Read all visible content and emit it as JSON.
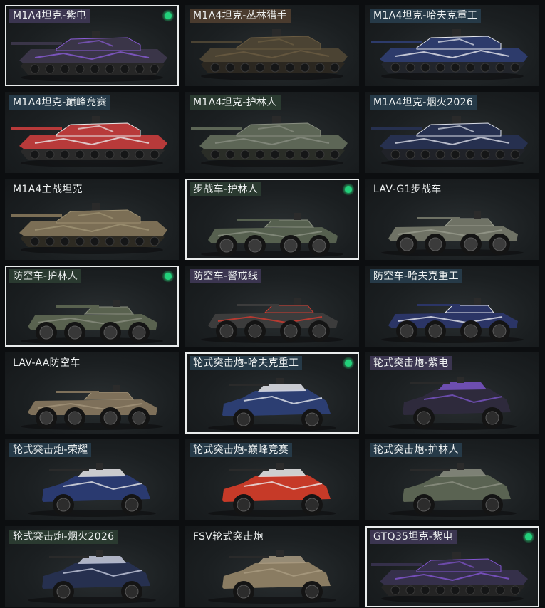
{
  "vehicles": [
    {
      "label": "M1A4坦克-紫电",
      "type": "tank",
      "selected": true,
      "label_bg": "#3b3550",
      "body": "#3a3548",
      "accent": "#8a5cd6",
      "wheel": "#262626"
    },
    {
      "label": "M1A4坦克-丛林猎手",
      "type": "tank",
      "selected": false,
      "label_bg": "#4a3b2e",
      "body": "#4b4333",
      "accent": "#6b5c42",
      "wheel": "#2b2720"
    },
    {
      "label": "M1A4坦克-哈夫克重工",
      "type": "tank",
      "selected": false,
      "label_bg": "#263a48",
      "body": "#2d3b6b",
      "accent": "#e7e9ef",
      "wheel": "#22252b"
    },
    {
      "label": "M1A4坦克-巅峰竞赛",
      "type": "tank",
      "selected": false,
      "label_bg": "#263a48",
      "body": "#b83a3a",
      "accent": "#e9e9ea",
      "wheel": "#2a2a2a"
    },
    {
      "label": "M1A4坦克-护林人",
      "type": "tank",
      "selected": false,
      "label_bg": "#2a3a30",
      "body": "#5d6656",
      "accent": "#8a8f82",
      "wheel": "#2a2d27"
    },
    {
      "label": "M1A4坦克-烟火2026",
      "type": "tank",
      "selected": false,
      "label_bg": "#263a48",
      "body": "#26304f",
      "accent": "#dcdfe8",
      "wheel": "#202228"
    },
    {
      "label": "M1A4主战坦克",
      "type": "tank",
      "selected": false,
      "label_bg": "transparent",
      "body": "#7b6e55",
      "accent": "#a09374",
      "wheel": "#2d2a22"
    },
    {
      "label": "步战车-护林人",
      "type": "ifv",
      "selected": true,
      "label_bg": "#2a3a30",
      "body": "#56604f",
      "accent": "#8b9182",
      "wheel": "#3a3a3a"
    },
    {
      "label": "LAV-G1步战车",
      "type": "ifv",
      "selected": false,
      "label_bg": "transparent",
      "body": "#6f7265",
      "accent": "#989b8d",
      "wheel": "#3b3b3b"
    },
    {
      "label": "防空车-护林人",
      "type": "ifv",
      "selected": true,
      "label_bg": "#2a3a30",
      "body": "#59624f",
      "accent": "#8a8f80",
      "wheel": "#383838"
    },
    {
      "label": "防空车-警戒线",
      "type": "ifv",
      "selected": false,
      "label_bg": "#3b3550",
      "body": "#3c3c3c",
      "accent": "#d43a2e",
      "wheel": "#353535"
    },
    {
      "label": "防空车-哈夫克重工",
      "type": "ifv",
      "selected": false,
      "label_bg": "#263a48",
      "body": "#2b3566",
      "accent": "#e7e9ef",
      "wheel": "#353535"
    },
    {
      "label": "LAV-AA防空车",
      "type": "ifv",
      "selected": false,
      "label_bg": "transparent",
      "body": "#7e705a",
      "accent": "#a29479",
      "wheel": "#383838"
    },
    {
      "label": "轮式突击炮-哈夫克重工",
      "type": "car",
      "selected": true,
      "label_bg": "#263a48",
      "body": "#2c3e72",
      "accent": "#e6e8ee",
      "wheel": "#2e2e2e"
    },
    {
      "label": "轮式突击炮-紫电",
      "type": "car",
      "selected": false,
      "label_bg": "#3b3550",
      "body": "#2e2a3c",
      "accent": "#7a55c8",
      "wheel": "#2c2c2c"
    },
    {
      "label": "轮式突击炮-荣耀",
      "type": "car",
      "selected": false,
      "label_bg": "#263a48",
      "body": "#2a3a70",
      "accent": "#e8e8ea",
      "wheel": "#2c2c2c"
    },
    {
      "label": "轮式突击炮-巅峰竞赛",
      "type": "car",
      "selected": false,
      "label_bg": "#263a48",
      "body": "#c63a28",
      "accent": "#ececec",
      "wheel": "#2c2c2c"
    },
    {
      "label": "轮式突击炮-护林人",
      "type": "car",
      "selected": false,
      "label_bg": "#263a48",
      "body": "#5a6352",
      "accent": "#8d9183",
      "wheel": "#2c2c2c"
    },
    {
      "label": "轮式突击炮-烟火2026",
      "type": "car",
      "selected": false,
      "label_bg": "#2a3a30",
      "body": "#26304f",
      "accent": "#c8cde0",
      "wheel": "#2c2c2c"
    },
    {
      "label": "FSV轮式突击炮",
      "type": "car",
      "selected": false,
      "label_bg": "transparent",
      "body": "#8a7c62",
      "accent": "#aa9c82",
      "wheel": "#2c2c2c"
    },
    {
      "label": "GTQ35坦克-紫电",
      "type": "tank",
      "selected": true,
      "label_bg": "#3b3550",
      "body": "#35304a",
      "accent": "#8456d2",
      "wheel": "#242424"
    }
  ]
}
